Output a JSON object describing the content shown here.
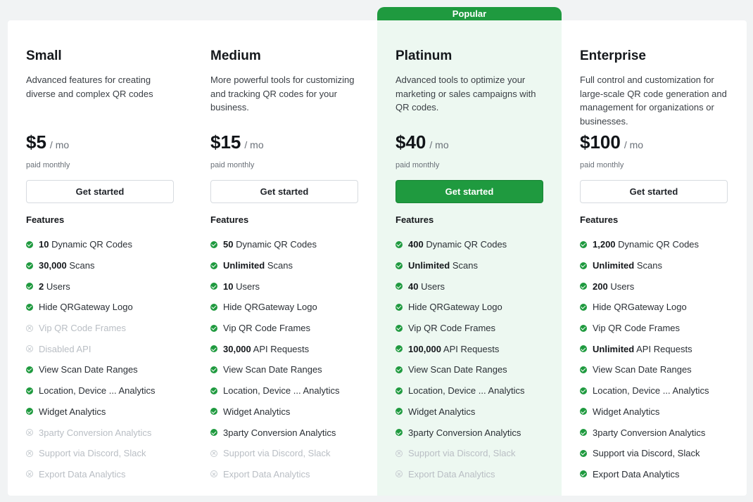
{
  "popular_label": "Popular",
  "plans": [
    {
      "name": "Small",
      "description": "Advanced features for creating diverse and complex QR codes",
      "price": "$5",
      "per": "/ mo",
      "billing": "paid monthly",
      "cta": "Get started",
      "features_title": "Features",
      "features": [
        {
          "bold": "10",
          "text": " Dynamic QR Codes",
          "enabled": true
        },
        {
          "bold": "30,000",
          "text": " Scans",
          "enabled": true
        },
        {
          "bold": "2",
          "text": " Users",
          "enabled": true
        },
        {
          "bold": "",
          "text": "Hide QRGateway Logo",
          "enabled": true
        },
        {
          "bold": "",
          "text": "Vip QR Code Frames",
          "enabled": false
        },
        {
          "bold": "",
          "text": "Disabled API",
          "enabled": false
        },
        {
          "bold": "",
          "text": "View Scan Date Ranges",
          "enabled": true
        },
        {
          "bold": "",
          "text": "Location, Device ... Analytics",
          "enabled": true
        },
        {
          "bold": "",
          "text": "Widget Analytics",
          "enabled": true
        },
        {
          "bold": "",
          "text": "3party Conversion Analytics",
          "enabled": false
        },
        {
          "bold": "",
          "text": "Support via Discord, Slack",
          "enabled": false
        },
        {
          "bold": "",
          "text": "Export Data Analytics",
          "enabled": false
        }
      ]
    },
    {
      "name": "Medium",
      "description": "More powerful tools for customizing and tracking QR codes for your business.",
      "price": "$15",
      "per": "/ mo",
      "billing": "paid monthly",
      "cta": "Get started",
      "features_title": "Features",
      "features": [
        {
          "bold": "50",
          "text": " Dynamic QR Codes",
          "enabled": true
        },
        {
          "bold": "Unlimited",
          "text": " Scans",
          "enabled": true
        },
        {
          "bold": "10",
          "text": " Users",
          "enabled": true
        },
        {
          "bold": "",
          "text": "Hide QRGateway Logo",
          "enabled": true
        },
        {
          "bold": "",
          "text": "Vip QR Code Frames",
          "enabled": true
        },
        {
          "bold": "30,000",
          "text": " API Requests",
          "enabled": true
        },
        {
          "bold": "",
          "text": "View Scan Date Ranges",
          "enabled": true
        },
        {
          "bold": "",
          "text": "Location, Device ... Analytics",
          "enabled": true
        },
        {
          "bold": "",
          "text": "Widget Analytics",
          "enabled": true
        },
        {
          "bold": "",
          "text": "3party Conversion Analytics",
          "enabled": true
        },
        {
          "bold": "",
          "text": "Support via Discord, Slack",
          "enabled": false
        },
        {
          "bold": "",
          "text": "Export Data Analytics",
          "enabled": false
        }
      ]
    },
    {
      "name": "Platinum",
      "description": "Advanced tools to optimize your marketing or sales campaigns with QR codes.",
      "price": "$40",
      "per": "/ mo",
      "billing": "paid monthly",
      "cta": "Get started",
      "features_title": "Features",
      "features": [
        {
          "bold": "400",
          "text": " Dynamic QR Codes",
          "enabled": true
        },
        {
          "bold": "Unlimited",
          "text": " Scans",
          "enabled": true
        },
        {
          "bold": "40",
          "text": " Users",
          "enabled": true
        },
        {
          "bold": "",
          "text": "Hide QRGateway Logo",
          "enabled": true
        },
        {
          "bold": "",
          "text": "Vip QR Code Frames",
          "enabled": true
        },
        {
          "bold": "100,000",
          "text": " API Requests",
          "enabled": true
        },
        {
          "bold": "",
          "text": "View Scan Date Ranges",
          "enabled": true
        },
        {
          "bold": "",
          "text": "Location, Device ... Analytics",
          "enabled": true
        },
        {
          "bold": "",
          "text": "Widget Analytics",
          "enabled": true
        },
        {
          "bold": "",
          "text": "3party Conversion Analytics",
          "enabled": true
        },
        {
          "bold": "",
          "text": "Support via Discord, Slack",
          "enabled": false
        },
        {
          "bold": "",
          "text": "Export Data Analytics",
          "enabled": false
        }
      ]
    },
    {
      "name": "Enterprise",
      "description": "Full control and customization for large-scale QR code generation and management for organizations or businesses.",
      "price": "$100",
      "per": "/ mo",
      "billing": "paid monthly",
      "cta": "Get started",
      "features_title": "Features",
      "features": [
        {
          "bold": "1,200",
          "text": " Dynamic QR Codes",
          "enabled": true
        },
        {
          "bold": "Unlimited",
          "text": " Scans",
          "enabled": true
        },
        {
          "bold": "200",
          "text": " Users",
          "enabled": true
        },
        {
          "bold": "",
          "text": "Hide QRGateway Logo",
          "enabled": true
        },
        {
          "bold": "",
          "text": "Vip QR Code Frames",
          "enabled": true
        },
        {
          "bold": "Unlimited",
          "text": " API Requests",
          "enabled": true
        },
        {
          "bold": "",
          "text": "View Scan Date Ranges",
          "enabled": true
        },
        {
          "bold": "",
          "text": "Location, Device ... Analytics",
          "enabled": true
        },
        {
          "bold": "",
          "text": "Widget Analytics",
          "enabled": true
        },
        {
          "bold": "",
          "text": "3party Conversion Analytics",
          "enabled": true
        },
        {
          "bold": "",
          "text": "Support via Discord, Slack",
          "enabled": true
        },
        {
          "bold": "",
          "text": "Export Data Analytics",
          "enabled": true
        }
      ]
    }
  ],
  "colors": {
    "accent": "#1f9a3f",
    "highlight_bg": "#edf8f1",
    "disabled_text": "#b9bec4"
  }
}
